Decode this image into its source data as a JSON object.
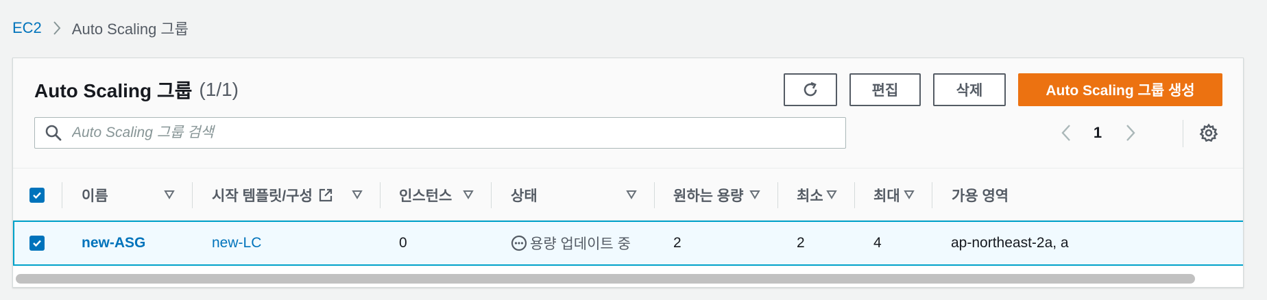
{
  "breadcrumb": {
    "root": "EC2",
    "current": "Auto Scaling 그룹"
  },
  "header": {
    "title": "Auto Scaling 그룹",
    "count": "(1/1)",
    "refresh_icon": "refresh-icon",
    "edit_label": "편집",
    "delete_label": "삭제",
    "create_label": "Auto Scaling 그룹 생성"
  },
  "search": {
    "placeholder": "Auto Scaling 그룹 검색",
    "value": ""
  },
  "pagination": {
    "current_page": "1"
  },
  "table": {
    "columns": {
      "name": "이름",
      "template": "시작 템플릿/구성",
      "instances": "인스턴스",
      "status": "상태",
      "desired": "원하는 용량",
      "min": "최소",
      "max": "최대",
      "az": "가용 영역"
    },
    "rows": [
      {
        "selected": true,
        "name": "new-ASG",
        "template": "new-LC",
        "instances": "0",
        "status": "용량 업데이트 중",
        "desired": "2",
        "min": "2",
        "max": "4",
        "az": "ap-northeast-2a, a"
      }
    ]
  },
  "colors": {
    "link": "#0073bb",
    "primary": "#ec7211",
    "selected_row_bg": "#f1faff",
    "selected_row_border": "#00a1c9"
  }
}
